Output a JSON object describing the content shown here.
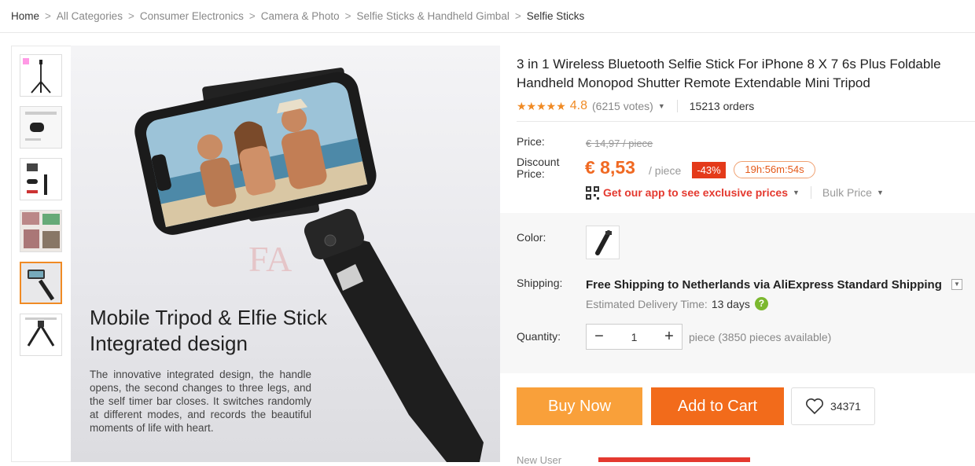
{
  "breadcrumb": [
    "Home",
    "All Categories",
    "Consumer Electronics",
    "Camera & Photo",
    "Selfie Sticks & Handheld Gimbal",
    "Selfie Sticks"
  ],
  "breadcrumb_sep": ">",
  "image": {
    "headline_line1": "Mobile Tripod & Elfie Stick",
    "headline_line2": "Integrated design",
    "body": "The innovative integrated design, the handle opens, the second changes to three legs, and the self timer bar closes. It switches randomly at different modes, and records the beautiful moments of life with heart.",
    "watermark": "FA"
  },
  "product": {
    "title": "3 in 1 Wireless Bluetooth Selfie Stick For iPhone 8 X 7 6s Plus Foldable Handheld Monopod Shutter Remote Extendable Mini Tripod",
    "stars": "★★★★★",
    "rating": "4.8",
    "votes": "(6215 votes)",
    "orders": "15213 orders"
  },
  "price": {
    "price_label": "Price:",
    "old": "€ 14,97 / piece",
    "discount_label_1": "Discount",
    "discount_label_2": "Price:",
    "new": "€ 8,53",
    "per": "/ piece",
    "discount": "-43%",
    "timer": "19h:56m:54s",
    "app_text": "Get our app to see exclusive prices",
    "bulk": "Bulk Price"
  },
  "options": {
    "color_label": "Color:",
    "shipping_label": "Shipping:",
    "shipping_bold": "Free Shipping to Netherlands via AliExpress Standard Shipping",
    "est_label": "Estimated Delivery Time:",
    "est_days": "13 days",
    "qmark": "?",
    "qty_label": "Quantity:",
    "qty_value": "1",
    "qty_minus": "−",
    "qty_plus": "+",
    "qty_avail": "piece (3850 pieces available)"
  },
  "actions": {
    "buy": "Buy Now",
    "cart": "Add to Cart",
    "wishlist_count": "34371"
  },
  "footer_cut": "New User",
  "colors": {
    "orange": "#f06922",
    "buy": "#f9a03a",
    "cart": "#f26b1b",
    "red": "#e4392f"
  }
}
